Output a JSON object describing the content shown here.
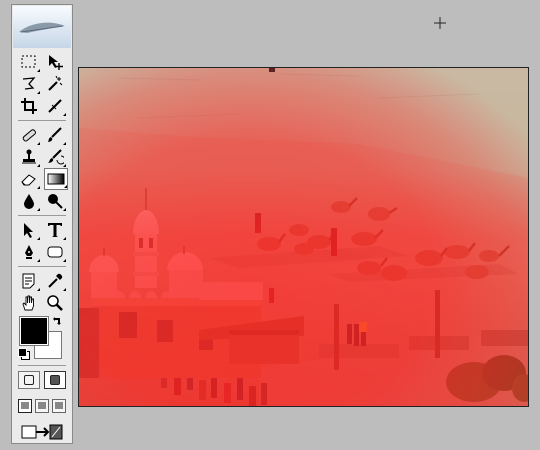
{
  "toolbox": {
    "tools": [
      {
        "id": "marquee",
        "icon": "rectangular-marquee-icon"
      },
      {
        "id": "move",
        "icon": "move-icon"
      },
      {
        "id": "lasso",
        "icon": "polygonal-lasso-icon"
      },
      {
        "id": "magic-wand",
        "icon": "magic-wand-icon"
      },
      {
        "id": "crop",
        "icon": "crop-icon"
      },
      {
        "id": "slice",
        "icon": "slice-icon"
      },
      {
        "id": "healing",
        "icon": "healing-brush-icon"
      },
      {
        "id": "brush",
        "icon": "brush-icon"
      },
      {
        "id": "stamp",
        "icon": "clone-stamp-icon"
      },
      {
        "id": "history-brush",
        "icon": "history-brush-icon"
      },
      {
        "id": "eraser",
        "icon": "eraser-icon"
      },
      {
        "id": "gradient",
        "icon": "gradient-icon",
        "active": true
      },
      {
        "id": "blur",
        "icon": "blur-icon"
      },
      {
        "id": "dodge",
        "icon": "dodge-icon"
      },
      {
        "id": "path-select",
        "icon": "path-selection-icon"
      },
      {
        "id": "type",
        "icon": "type-icon",
        "label": "T"
      },
      {
        "id": "pen",
        "icon": "pen-icon"
      },
      {
        "id": "shape",
        "icon": "rounded-rectangle-shape-icon"
      },
      {
        "id": "notes",
        "icon": "notes-icon"
      },
      {
        "id": "eyedropper",
        "icon": "eyedropper-icon"
      },
      {
        "id": "hand",
        "icon": "hand-icon"
      },
      {
        "id": "zoom",
        "icon": "zoom-icon"
      }
    ],
    "colors": {
      "foreground": "#000000",
      "background": "#ffffff"
    },
    "quick_mask": {
      "selected": "quick-mask"
    },
    "screen_mode": {
      "selected": "standard"
    }
  },
  "canvas": {
    "overlay_color": "#ff2020",
    "sand_color": "#cbb89e"
  }
}
